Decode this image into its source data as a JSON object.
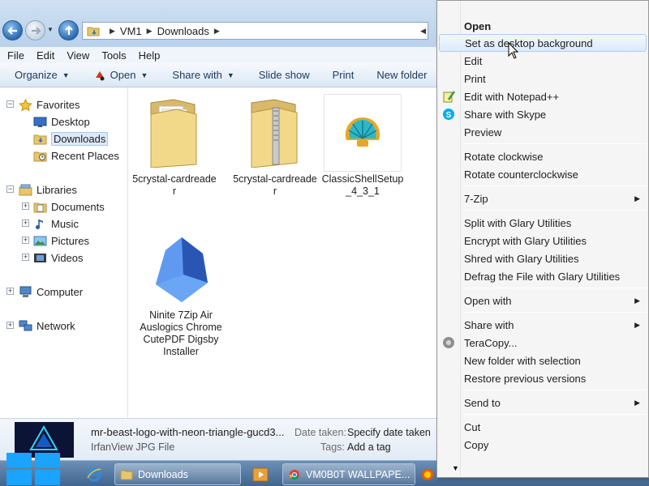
{
  "window": {
    "address": {
      "crumbs": [
        "VM1",
        "Downloads"
      ]
    },
    "menu": [
      "File",
      "Edit",
      "View",
      "Tools",
      "Help"
    ],
    "commands": {
      "organize": "Organize",
      "open": "Open",
      "share_with": "Share with",
      "slide_show": "Slide show",
      "print": "Print",
      "new_folder": "New folder"
    }
  },
  "nav": {
    "favorites": "Favorites",
    "desktop": "Desktop",
    "downloads": "Downloads",
    "recent": "Recent Places",
    "libraries": "Libraries",
    "documents": "Documents",
    "music": "Music",
    "pictures": "Pictures",
    "videos": "Videos",
    "computer": "Computer",
    "network": "Network"
  },
  "files": [
    {
      "name": "5crystal-cardreader",
      "icon": "folder-icon"
    },
    {
      "name": "5crystal-cardreader",
      "icon": "zip-folder-icon"
    },
    {
      "name": "ClassicShellSetup_4_3_1",
      "icon": "classic-shell-icon"
    },
    {
      "name": "Ninite 7Zip Air Auslogics Chrome CutePDF Digsby Installer",
      "icon": "ninite-icon"
    }
  ],
  "details": {
    "name": "mr-beast-logo-with-neon-triangle-gucd3...",
    "type": "IrfanView JPG File",
    "date_key": "Date taken:",
    "date_val": "Specify date taken",
    "tags_key": "Tags:",
    "tags_val": "Add a tag"
  },
  "taskbar": {
    "downloads": "Downloads",
    "chrome": "VM0B0T WALLPAPE..."
  },
  "context_menu": {
    "open": "Open",
    "set_bg": "Set as desktop background",
    "edit": "Edit",
    "print": "Print",
    "edit_npp": "Edit with Notepad++",
    "share_skype": "Share with Skype",
    "preview": "Preview",
    "rotate_cw": "Rotate clockwise",
    "rotate_ccw": "Rotate counterclockwise",
    "zip7": "7-Zip",
    "split": "Split with Glary Utilities",
    "encrypt": "Encrypt with Glary Utilities",
    "shred": "Shred with Glary Utilities",
    "defrag": "Defrag the File with Glary Utilities",
    "open_with": "Open with",
    "share_with": "Share with",
    "teracopy": "TeraCopy...",
    "new_folder_sel": "New folder with selection",
    "restore": "Restore previous versions",
    "send_to": "Send to",
    "cut": "Cut",
    "copy": "Copy"
  }
}
